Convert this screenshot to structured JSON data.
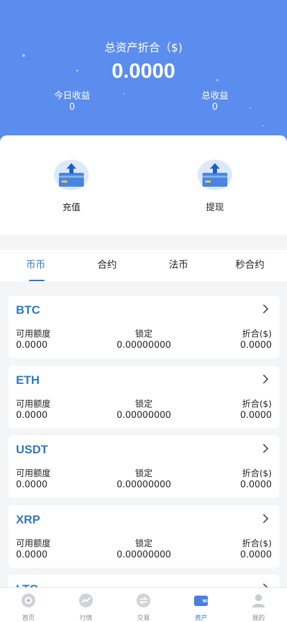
{
  "summary": {
    "title": "总资产折合（$)",
    "amount": "0.0000",
    "today_label": "今日收益",
    "today_value": "0",
    "total_label": "总收益",
    "total_value": "0"
  },
  "actions": {
    "deposit_label": "充值",
    "withdraw_label": "提现"
  },
  "tabs": [
    {
      "label": "币币",
      "active": true
    },
    {
      "label": "合约",
      "active": false
    },
    {
      "label": "法币",
      "active": false
    },
    {
      "label": "秒合约",
      "active": false
    }
  ],
  "columns": {
    "available": "可用额度",
    "locked": "锁定",
    "equivalent": "折合($)"
  },
  "assets": [
    {
      "symbol": "BTC",
      "available": "0.0000",
      "locked": "0.00000000",
      "equivalent": "0.0000"
    },
    {
      "symbol": "ETH",
      "available": "0.0000",
      "locked": "0.00000000",
      "equivalent": "0.0000"
    },
    {
      "symbol": "USDT",
      "available": "0.0000",
      "locked": "0.00000000",
      "equivalent": "0.0000"
    },
    {
      "symbol": "XRP",
      "available": "0.0000",
      "locked": "0.00000000",
      "equivalent": "0.0000"
    },
    {
      "symbol": "LTC"
    }
  ],
  "nav": [
    {
      "label": "首页",
      "icon": "home-icon",
      "active": false
    },
    {
      "label": "行情",
      "icon": "market-chart-icon",
      "active": false
    },
    {
      "label": "交易",
      "icon": "trade-exchange-icon",
      "active": false
    },
    {
      "label": "资产",
      "icon": "wallet-icon",
      "active": true
    },
    {
      "label": "我的",
      "icon": "user-icon",
      "active": false
    }
  ],
  "colors": {
    "header_bg": "#5b8def",
    "accent": "#2b78c5",
    "page_bg": "#f4f5f7"
  }
}
